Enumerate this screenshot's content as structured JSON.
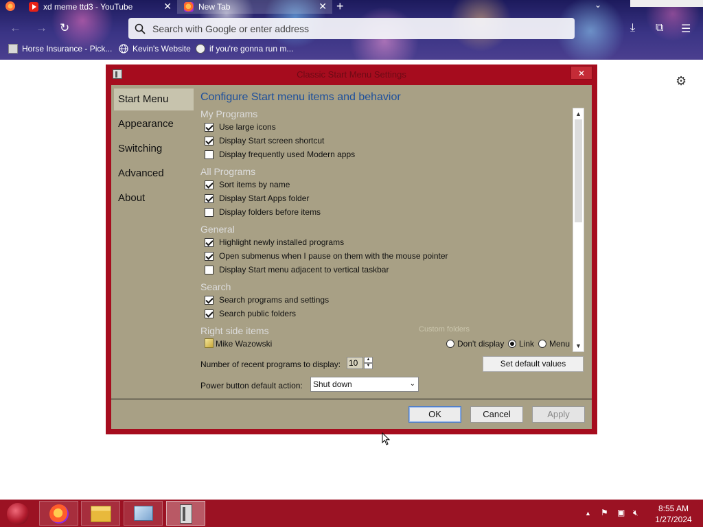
{
  "browser": {
    "tabs": [
      {
        "label": "xd meme ttd3 - YouTube",
        "icon": "youtube-icon",
        "active": false
      },
      {
        "label": "New Tab",
        "icon": "firefox-icon",
        "active": true
      }
    ],
    "urlbar_placeholder": "Search with Google or enter address",
    "bookmarks": [
      {
        "label": "Horse Insurance - Pick...",
        "icon": "bookmark-page-icon"
      },
      {
        "label": "Kevin's Website",
        "icon": "globe-icon"
      },
      {
        "label": "if you're gonna run m...",
        "icon": "bookmark-site-icon"
      }
    ]
  },
  "dialog": {
    "title": "Classic Start Menu Settings",
    "sidebar": [
      "Start Menu",
      "Appearance",
      "Switching",
      "Advanced",
      "About"
    ],
    "active_section": "Start Menu",
    "heading": "Configure Start menu items and behavior",
    "groups": [
      {
        "title": "My Programs",
        "options": [
          {
            "label": "Use large icons",
            "checked": true
          },
          {
            "label": "Display Start screen shortcut",
            "checked": true
          },
          {
            "label": "Display frequently used Modern apps",
            "checked": false
          }
        ]
      },
      {
        "title": "All Programs",
        "options": [
          {
            "label": "Sort items by name",
            "checked": true
          },
          {
            "label": "Display Start Apps folder",
            "checked": true
          },
          {
            "label": "Display folders before items",
            "checked": false
          }
        ]
      },
      {
        "title": "General",
        "options": [
          {
            "label": "Highlight newly installed programs",
            "checked": true
          },
          {
            "label": "Open submenus when I pause on them with the mouse pointer",
            "checked": true
          },
          {
            "label": "Display Start menu adjacent to vertical taskbar",
            "checked": false
          }
        ]
      },
      {
        "title": "Search",
        "options": [
          {
            "label": "Search programs and settings",
            "checked": true
          },
          {
            "label": "Search public folders",
            "checked": true
          }
        ]
      }
    ],
    "right_side": {
      "title": "Right side items",
      "custom_folders": "Custom folders",
      "item_name": "Mike Wazowski",
      "radio_options": [
        "Don't display",
        "Link",
        "Menu"
      ],
      "selected": "Link"
    },
    "recent_label": "Number of recent programs to display:",
    "recent_value": "10",
    "set_default_label": "Set default values",
    "power_label": "Power button default action:",
    "power_value": "Shut down",
    "buttons": {
      "ok": "OK",
      "cancel": "Cancel",
      "apply": "Apply"
    }
  },
  "taskbar": {
    "apps": [
      "firefox-icon",
      "file-explorer-icon",
      "resource-monitor-icon",
      "classic-start-settings-icon"
    ],
    "active_app": "classic-start-settings-icon",
    "time": "8:55 AM",
    "date": "1/27/2024"
  },
  "colors": {
    "dialog_frame": "#a60c1e",
    "dialog_body": "#a8a085",
    "heading": "#1c4f9c",
    "taskbar": "#9b1223"
  }
}
